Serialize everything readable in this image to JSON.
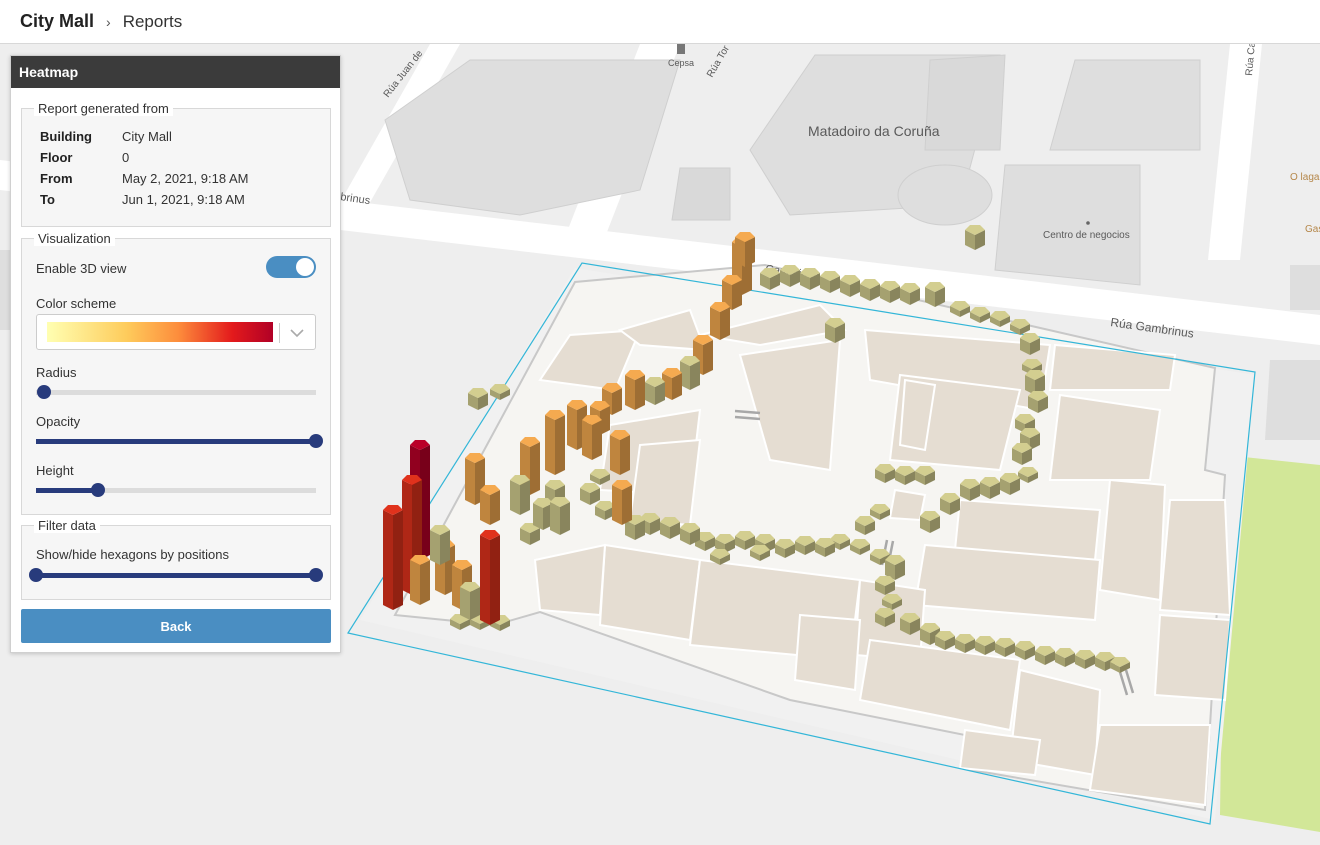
{
  "header": {
    "root": "City Mall",
    "separator": "›",
    "current": "Reports"
  },
  "panel": {
    "title": "Heatmap",
    "report": {
      "legend": "Report generated from",
      "rows": [
        {
          "key": "Building",
          "value": "City Mall"
        },
        {
          "key": "Floor",
          "value": "0"
        },
        {
          "key": "From",
          "value": "May 2, 2021, 9:18 AM"
        },
        {
          "key": "To",
          "value": "Jun 1, 2021, 9:18 AM"
        }
      ]
    },
    "visualization": {
      "legend": "Visualization",
      "enable_3d_label": "Enable 3D view",
      "enable_3d": true,
      "color_scheme_label": "Color scheme",
      "color_scheme": [
        "#ffffb2",
        "#fecc5c",
        "#fd8d3c",
        "#e31a1c",
        "#b10026"
      ],
      "radius_label": "Radius",
      "radius_level": 0.03,
      "opacity_label": "Opacity",
      "opacity_level": 1.0,
      "height_label": "Height",
      "height_level": 0.22
    },
    "filter": {
      "legend": "Filter data",
      "positions_label": "Show/hide hexagons by positions",
      "range": [
        0.0,
        1.0
      ]
    },
    "back_label": "Back"
  },
  "map": {
    "labels": {
      "matadoiro": "Matadoiro da Coruña",
      "centro": "Centro de negocios",
      "cepsa": "Cepsa",
      "gambrinus_street": "Rúa Gambrinus",
      "gambrinus_left": "Gambrinus",
      "gambrinus_left2": "brinus",
      "rua_juan": "Rúa Juan de",
      "rua_tor": "Rúa Tor",
      "rua_ca": "Rúa Ca",
      "o_lagar": "O lagar",
      "gas": "Gas"
    },
    "colors": {
      "low": "#c9c489",
      "mid": "#e9a24c",
      "high": "#d5301b",
      "max": "#b10026",
      "outline": "#33b6d8",
      "park": "#d2e798"
    }
  }
}
